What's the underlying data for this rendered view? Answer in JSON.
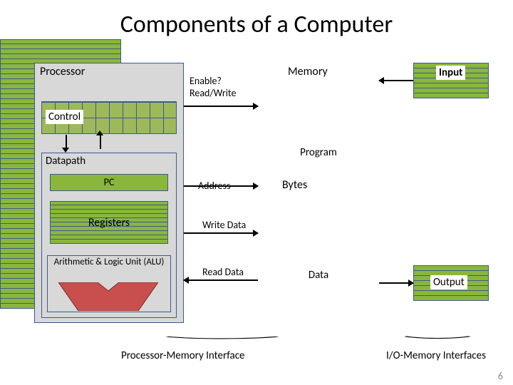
{
  "title": "Components of a Computer",
  "processor": {
    "label": "Processor",
    "control": "Control",
    "datapath": "Datapath",
    "pc": "PC",
    "registers": "Registers",
    "alu": "Arithmetic & Logic Unit (ALU)"
  },
  "memory": {
    "label": "Memory",
    "program": "Program",
    "bytes": "Bytes",
    "data": "Data"
  },
  "bus": {
    "enable": "Enable? Read/Write",
    "address": "Address",
    "write_data": "Write Data",
    "read_data": "Read Data"
  },
  "io": {
    "input": "Input",
    "output": "Output"
  },
  "footer": {
    "pmi": "Processor-Memory Interface",
    "io_if": "I/O-Memory Interfaces",
    "page": "6"
  }
}
